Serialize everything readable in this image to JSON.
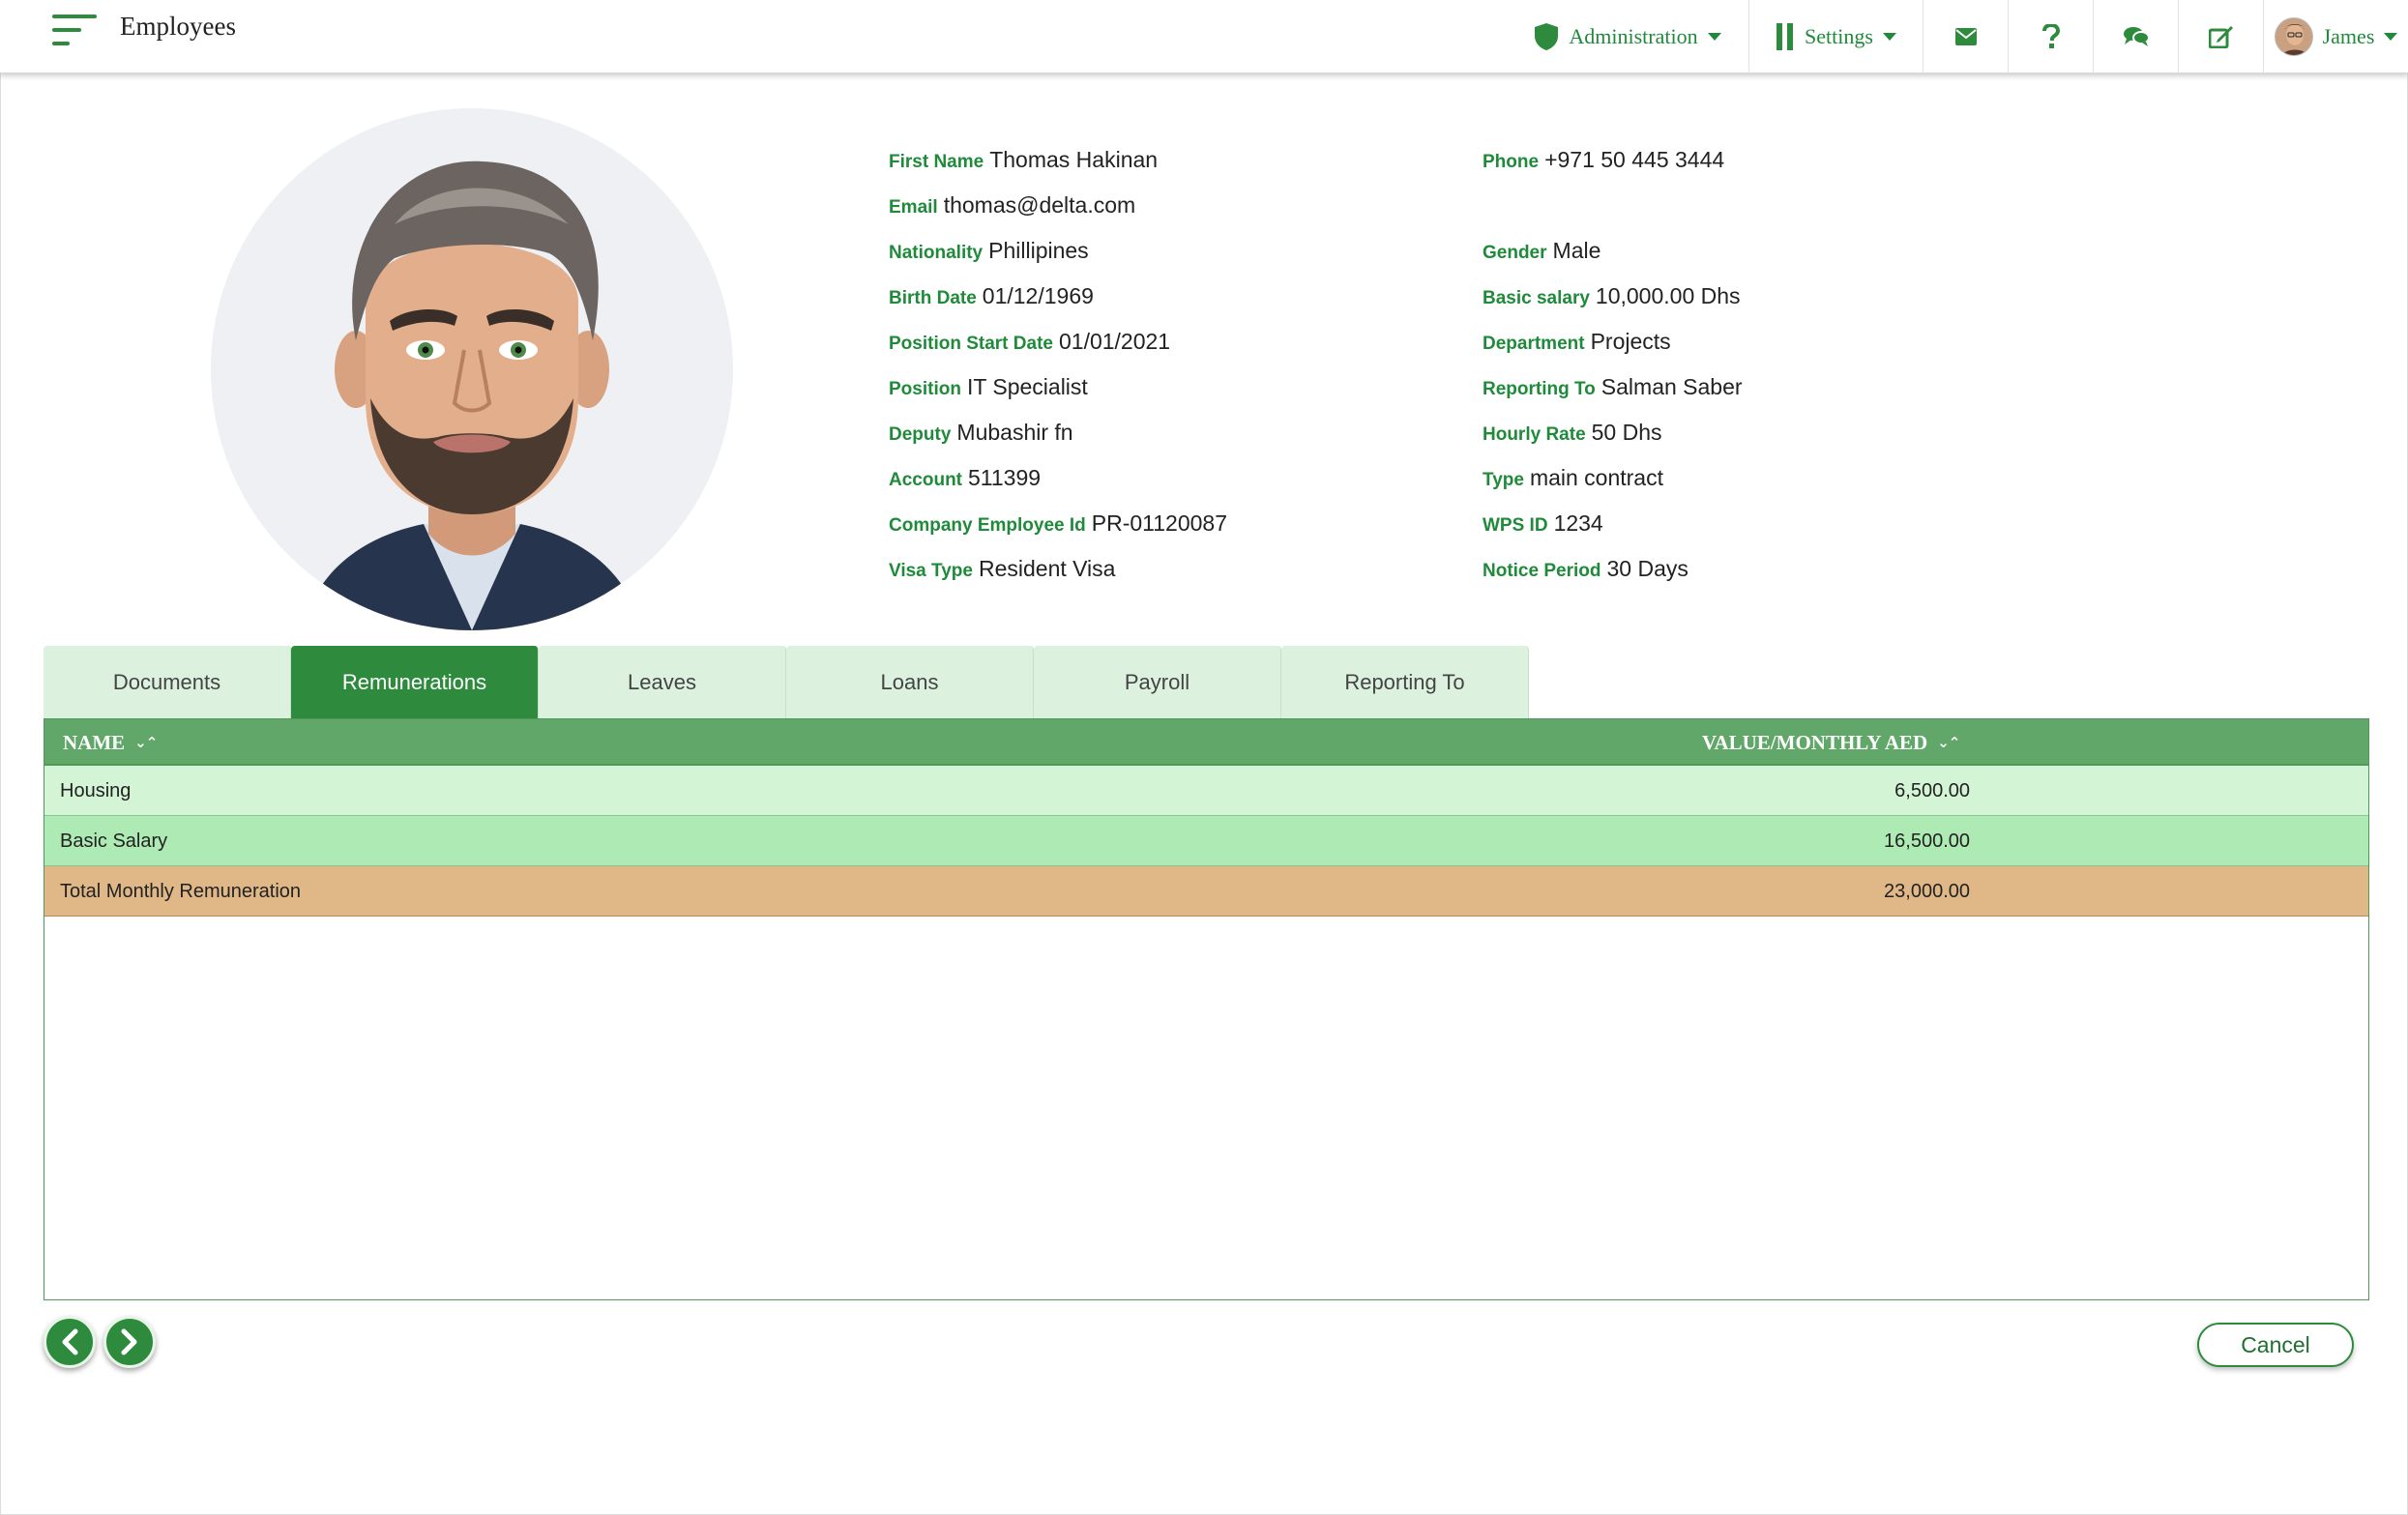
{
  "header": {
    "title": "Employees",
    "nav": {
      "administration": "Administration",
      "settings": "Settings",
      "user": "James"
    }
  },
  "profile": {
    "left": [
      {
        "label": "First Name",
        "value": "Thomas Hakinan"
      },
      {
        "label": "Email",
        "value": "thomas@delta.com"
      },
      {
        "label": "Nationality",
        "value": "Phillipines"
      },
      {
        "label": "Birth Date",
        "value": "01/12/1969"
      },
      {
        "label": "Position Start Date",
        "value": "01/01/2021"
      },
      {
        "label": "Position",
        "value": "IT Specialist"
      },
      {
        "label": "Deputy",
        "value": "Mubashir fn"
      },
      {
        "label": "Account",
        "value": "511399"
      },
      {
        "label": "Company Employee Id",
        "value": "PR-01120087"
      },
      {
        "label": "Visa Type",
        "value": "Resident Visa"
      }
    ],
    "right": [
      {
        "label": "Phone",
        "value": "+971 50 445 3444"
      },
      {
        "label": "Gender",
        "value": "Male"
      },
      {
        "label": "Basic salary",
        "value": "10,000.00 Dhs"
      },
      {
        "label": "Department",
        "value": "Projects"
      },
      {
        "label": "Reporting To",
        "value": "Salman Saber"
      },
      {
        "label": "Hourly Rate",
        "value": "50 Dhs"
      },
      {
        "label": "Type",
        "value": "main contract"
      },
      {
        "label": "WPS ID",
        "value": "1234"
      },
      {
        "label": "Notice Period",
        "value": "30 Days"
      }
    ]
  },
  "tabs": [
    "Documents",
    "Remunerations",
    "Leaves",
    "Loans",
    "Payroll",
    "Reporting To"
  ],
  "active_tab": "Remunerations",
  "table": {
    "columns": {
      "name": "NAME",
      "value": "VALUE/MONTHLY AED"
    },
    "rows": [
      {
        "name": "Housing",
        "value": "6,500.00"
      },
      {
        "name": "Basic Salary",
        "value": "16,500.00"
      }
    ],
    "total": {
      "name": "Total Monthly Remuneration",
      "value": "23,000.00"
    }
  },
  "footer": {
    "cancel_label": "Cancel"
  },
  "colors": {
    "brand_green": "#2e8b3d",
    "header_green": "#62a76a",
    "row_light": "#d4f4d6",
    "row_mid": "#aeeab3",
    "row_total": "#e0b887"
  },
  "icons": [
    "menu-icon",
    "shield-icon",
    "settings-bars-icon",
    "envelope-icon",
    "question-icon",
    "chat-icon",
    "edit-icon",
    "chevron-left-icon",
    "chevron-right-icon"
  ]
}
